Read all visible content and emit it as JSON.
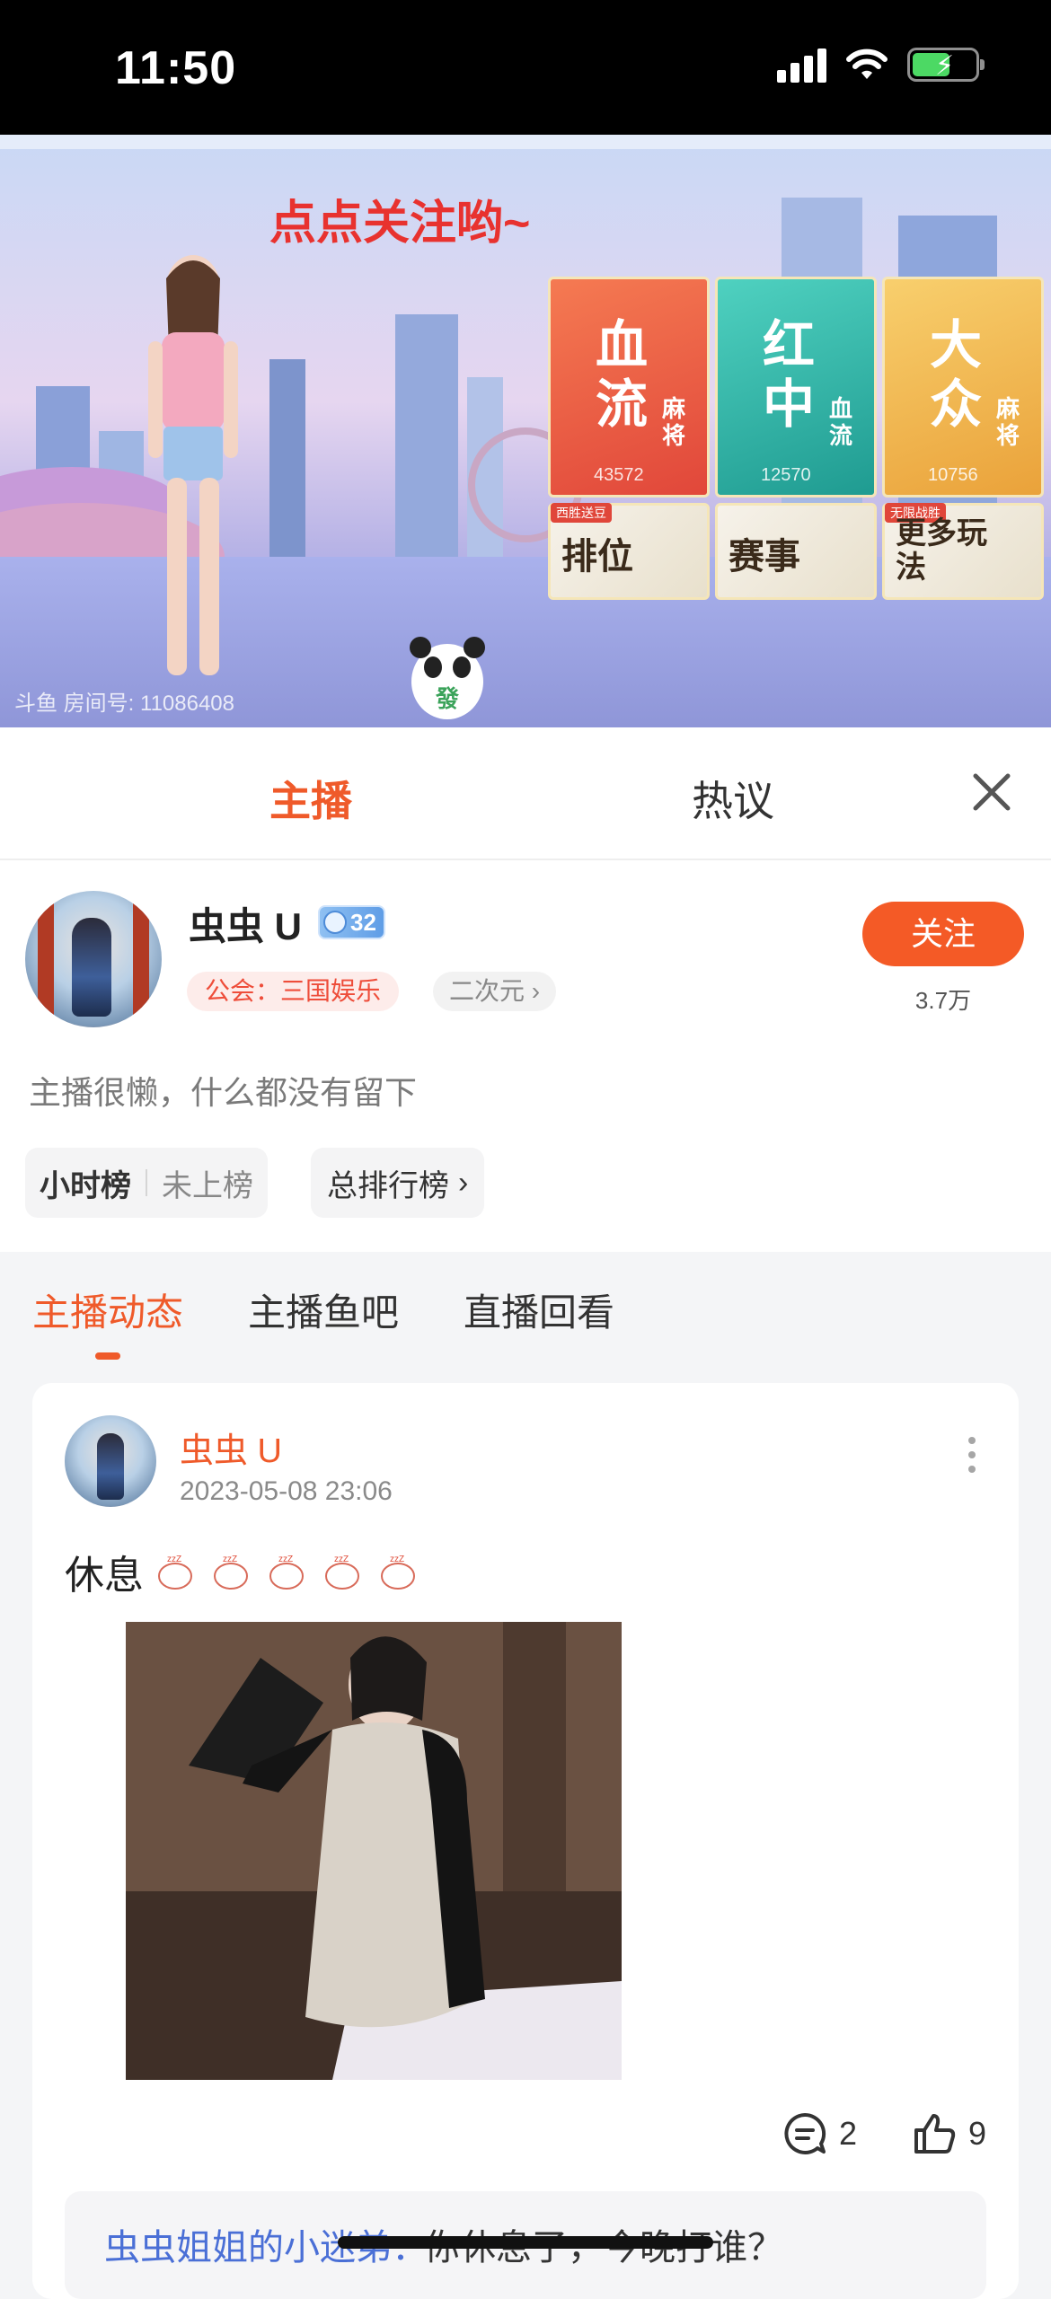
{
  "status_bar": {
    "time": "11:50"
  },
  "stream": {
    "follow_hint": "点点关注哟~",
    "room_id": "斗鱼 房间号: 11086408",
    "games": [
      {
        "title": "血流",
        "sub": "麻将",
        "count": "43572",
        "color": "#ef6b4a"
      },
      {
        "title": "红中",
        "sub": "血流",
        "count": "12570",
        "color": "#2fb5a8"
      },
      {
        "title": "大众",
        "sub": "麻将",
        "count": "10756",
        "color": "#f1b24a"
      }
    ],
    "modes": [
      {
        "label": "排位",
        "tag": "西胜送豆"
      },
      {
        "label": "赛事",
        "tag": ""
      },
      {
        "label": "更多玩法",
        "tag": "无限战胜"
      }
    ]
  },
  "panel": {
    "tabs": [
      "主播",
      "热议"
    ],
    "streamer": {
      "name": "虫虫 U",
      "level": "32",
      "guild": "公会：三国娱乐",
      "category": "二次元",
      "follow_label": "关注",
      "followers": "3.7万",
      "bio": "主播很懒，什么都没有留下",
      "hour_rank_label": "小时榜",
      "hour_rank_value": "未上榜",
      "total_rank_label": "总排行榜"
    }
  },
  "feed": {
    "tabs": [
      "主播动态",
      "主播鱼吧",
      "直播回看"
    ],
    "post": {
      "author": "虫虫 U",
      "time": "2023-05-08  23:06",
      "text": "休息",
      "comments": "2",
      "likes": "9",
      "comment_user": "虫虫姐姐的小迷弟：",
      "comment_text": "你休息了，今晚打谁？"
    }
  }
}
